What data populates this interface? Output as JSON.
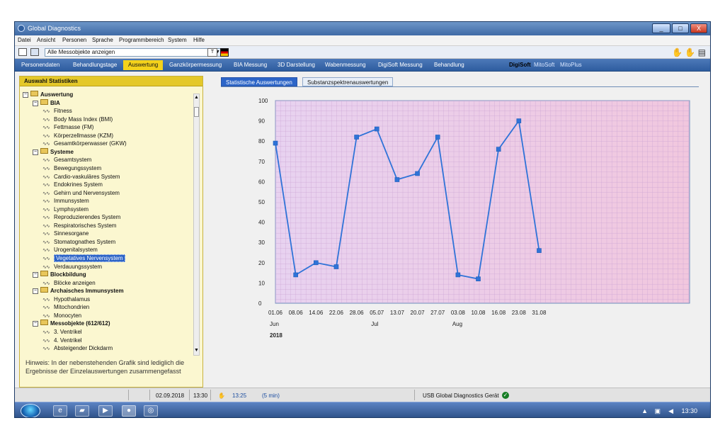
{
  "window": {
    "title": "Global Diagnostics",
    "controls": [
      "_",
      "□",
      "X"
    ]
  },
  "menu": [
    "Datei",
    "Ansicht",
    "Personen",
    "Sprache",
    "Programmbereich",
    "System",
    "Hilfe"
  ],
  "toolbar": {
    "select_value": "Alle Messobjekte anzeigen",
    "small_box_label": "T"
  },
  "nav": {
    "items": [
      "Personendaten",
      "Behandlungstage",
      "Auswertung",
      "Ganzkörpermessung",
      "BIA Messung",
      "3D Darstellung",
      "Wabenmessung",
      "DigiSoft Messung",
      "Behandlung"
    ],
    "active": "Auswertung",
    "soft_items": [
      "DigiSoft",
      "MitoSoft",
      "MitoPlus"
    ]
  },
  "left_panel": {
    "title": "Auswahl Statistiken",
    "tree": [
      {
        "level": 0,
        "type": "folder",
        "label": "Auswertung"
      },
      {
        "level": 1,
        "type": "folder",
        "label": "BIA"
      },
      {
        "level": 2,
        "type": "leaf",
        "label": "Fitness"
      },
      {
        "level": 2,
        "type": "leaf",
        "label": "Body Mass Index (BMI)"
      },
      {
        "level": 2,
        "type": "leaf",
        "label": "Fettmasse (FM)"
      },
      {
        "level": 2,
        "type": "leaf",
        "label": "Körperzellmasse (KZM)"
      },
      {
        "level": 2,
        "type": "leaf",
        "label": "Gesamtkörperwasser (GKW)"
      },
      {
        "level": 1,
        "type": "folder",
        "label": "Systeme"
      },
      {
        "level": 2,
        "type": "leaf",
        "label": "Gesamtsystem"
      },
      {
        "level": 2,
        "type": "leaf",
        "label": "Bewegungssystem"
      },
      {
        "level": 2,
        "type": "leaf",
        "label": "Cardio-vaskuläres System"
      },
      {
        "level": 2,
        "type": "leaf",
        "label": "Endokrines System"
      },
      {
        "level": 2,
        "type": "leaf",
        "label": "Gehirn und Nervensystem"
      },
      {
        "level": 2,
        "type": "leaf",
        "label": "Immunsystem"
      },
      {
        "level": 2,
        "type": "leaf",
        "label": "Lymphsystem"
      },
      {
        "level": 2,
        "type": "leaf",
        "label": "Reproduzierendes System"
      },
      {
        "level": 2,
        "type": "leaf",
        "label": "Respiratorisches System"
      },
      {
        "level": 2,
        "type": "leaf",
        "label": "Sinnesorgane"
      },
      {
        "level": 2,
        "type": "leaf",
        "label": "Stomatognathes System"
      },
      {
        "level": 2,
        "type": "leaf",
        "label": "Urogenitalsystem"
      },
      {
        "level": 2,
        "type": "leaf",
        "label": "Vegetatives Nervensystem",
        "selected": true
      },
      {
        "level": 2,
        "type": "leaf",
        "label": "Verdauungssystem"
      },
      {
        "level": 1,
        "type": "folder",
        "label": "Blockbildung"
      },
      {
        "level": 2,
        "type": "leaf",
        "label": "Blöcke anzeigen"
      },
      {
        "level": 1,
        "type": "folder",
        "label": "Archaisches Immunsystem"
      },
      {
        "level": 2,
        "type": "leaf",
        "label": "Hypothalamus"
      },
      {
        "level": 2,
        "type": "leaf",
        "label": "Mitochondrien"
      },
      {
        "level": 2,
        "type": "leaf",
        "label": "Monocyten"
      },
      {
        "level": 1,
        "type": "folder",
        "label": "Messobjekte (612/612)"
      },
      {
        "level": 2,
        "type": "leaf",
        "label": "3. Ventrikel"
      },
      {
        "level": 2,
        "type": "leaf",
        "label": "4. Ventrikel"
      },
      {
        "level": 2,
        "type": "leaf",
        "label": "Absteigender Dickdarm"
      }
    ],
    "hint": "Hinweis: In der nebenstehenden Grafik sind lediglich die Ergebnisse der Einzelauswertungen zusammengefasst"
  },
  "chart_tabs": [
    "Statistische Auswertungen",
    "Substanzspektrenauswertungen"
  ],
  "chart_data": {
    "type": "line",
    "title": "",
    "xlabel": "",
    "ylabel": "",
    "x": [
      "01.06",
      "08.06",
      "14.06",
      "22.06",
      "28.06",
      "05.07",
      "13.07",
      "20.07",
      "27.07",
      "03.08",
      "10.08",
      "16.08",
      "23.08",
      "31.08"
    ],
    "values": [
      79,
      14,
      20,
      18,
      82,
      86,
      61,
      64,
      82,
      14,
      12,
      76,
      90,
      26
    ],
    "month_labels": [
      {
        "label": "Jun",
        "at": "01.06"
      },
      {
        "label": "Jul",
        "at": "05.07"
      },
      {
        "label": "Aug",
        "at": "03.08"
      }
    ],
    "year_label": "2018",
    "ylim": [
      0,
      100
    ],
    "yticks": [
      0,
      10,
      20,
      30,
      40,
      50,
      60,
      70,
      80,
      90,
      100
    ],
    "grid": true,
    "colors": {
      "line": "#2f73d8",
      "marker": "#2f73d8",
      "grid": "#c8a2d2",
      "background_left": "#e8d2f0",
      "background_right": "#f1c7de"
    }
  },
  "status": {
    "date": "02.09.2018",
    "time": "13:30",
    "elapsed_start": "13:25",
    "duration": "(5 min)",
    "device": "USB Global Diagnostics Gerät"
  },
  "taskbar": {
    "clock": "13:30"
  }
}
